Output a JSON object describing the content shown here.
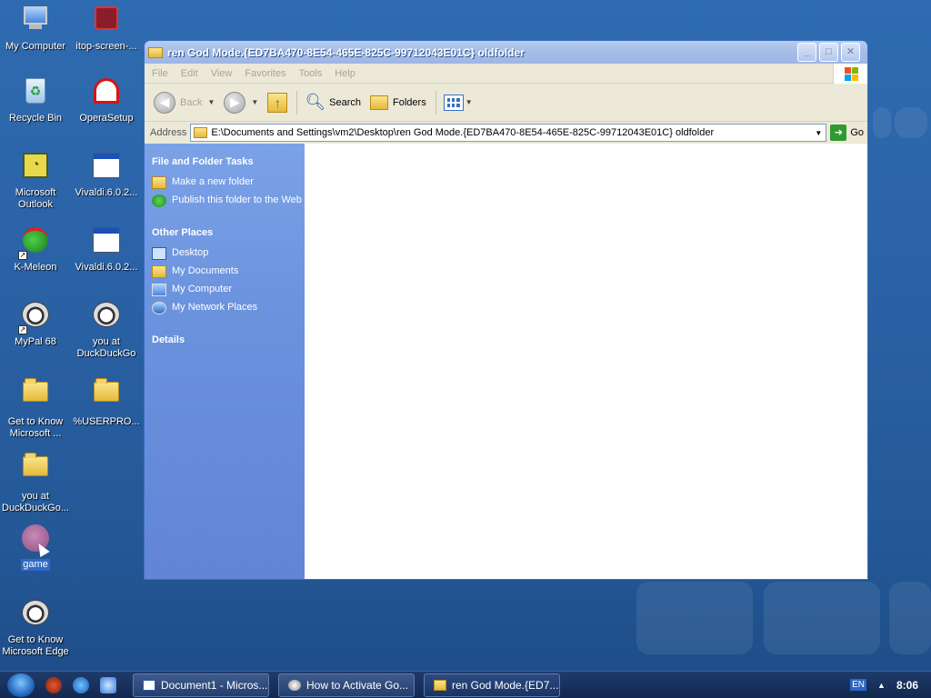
{
  "desktop": {
    "icons": [
      {
        "label": "My Computer"
      },
      {
        "label": "itop-screen-..."
      },
      {
        "label": "Recycle Bin"
      },
      {
        "label": "OperaSetup"
      },
      {
        "label": "Microsoft Outlook"
      },
      {
        "label": "Vivaldi.6.0.2..."
      },
      {
        "label": "K-Meleon"
      },
      {
        "label": "Vivaldi.6.0.2..."
      },
      {
        "label": "MyPal 68"
      },
      {
        "label": "you at DuckDuckGo"
      },
      {
        "label": "Get to Know Microsoft ..."
      },
      {
        "label": "%USERPRO..."
      },
      {
        "label": "you at DuckDuckGo..."
      },
      {
        "label": "game"
      },
      {
        "label": "Get to Know Microsoft Edge"
      }
    ]
  },
  "window": {
    "title": "ren God Mode.{ED7BA470-8E54-465E-825C-99712043E01C} oldfolder",
    "controls": {
      "minimize": "_",
      "maximize": "□",
      "close": "✕"
    },
    "menu": [
      "File",
      "Edit",
      "View",
      "Favorites",
      "Tools",
      "Help"
    ],
    "toolbar": {
      "back_label": "Back",
      "search_label": "Search",
      "folders_label": "Folders"
    },
    "address": {
      "label": "Address",
      "value": "E:\\Documents and Settings\\vm2\\Desktop\\ren God Mode.{ED7BA470-8E54-465E-825C-99712043E01C} oldfolder",
      "go_label": "Go"
    },
    "taskpane": {
      "file_folder_tasks": {
        "title": "File and Folder Tasks",
        "items": [
          "Make a new folder",
          "Publish this folder to the Web"
        ]
      },
      "other_places": {
        "title": "Other Places",
        "items": [
          "Desktop",
          "My Documents",
          "My Computer",
          "My Network Places"
        ]
      },
      "details": {
        "title": "Details"
      }
    }
  },
  "taskbar": {
    "tasks": [
      {
        "label": "Document1 - Micros..."
      },
      {
        "label": "How to Activate Go..."
      },
      {
        "label": "ren God Mode.{ED7..."
      }
    ],
    "language": "EN",
    "clock": "8:06"
  }
}
